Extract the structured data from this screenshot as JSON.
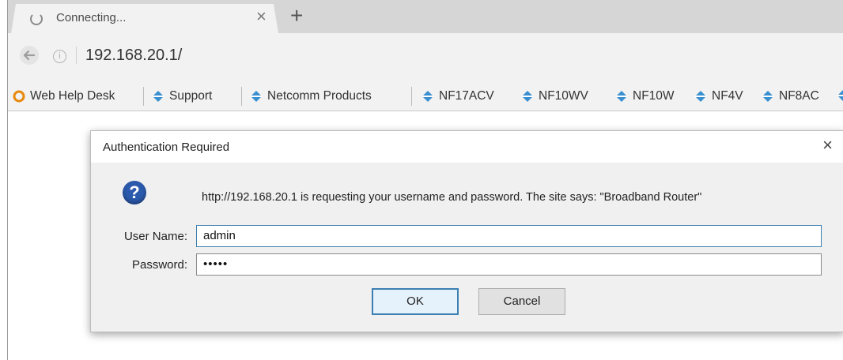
{
  "tab": {
    "title": "Connecting...",
    "close_glyph": "×",
    "new_tab_glyph": "+"
  },
  "address": {
    "url": "192.168.20.1/"
  },
  "bookmarks": [
    {
      "label": "Web Help Desk",
      "icon": "orange-ring-icon"
    },
    {
      "label": "Support",
      "icon": "netcomm-icon"
    },
    {
      "label": "Netcomm Products",
      "icon": "netcomm-icon"
    },
    {
      "label": "NF17ACV",
      "icon": "netcomm-icon"
    },
    {
      "label": "NF10WV",
      "icon": "netcomm-icon"
    },
    {
      "label": "NF10W",
      "icon": "netcomm-icon"
    },
    {
      "label": "NF4V",
      "icon": "netcomm-icon"
    },
    {
      "label": "NF8AC",
      "icon": "netcomm-icon"
    }
  ],
  "dialog": {
    "title": "Authentication Required",
    "close_glyph": "×",
    "help_glyph": "?",
    "message": "http://192.168.20.1 is requesting your username and password. The site says: \"Broadband Router\"",
    "username_label": "User Name:",
    "username_value": "admin",
    "password_label": "Password:",
    "password_value": "•••••",
    "ok_label": "OK",
    "cancel_label": "Cancel"
  },
  "colors": {
    "accent": "#3c7fb1",
    "bookmark_icon": "#3a8fd0",
    "help_icon": "#2b5aad"
  }
}
